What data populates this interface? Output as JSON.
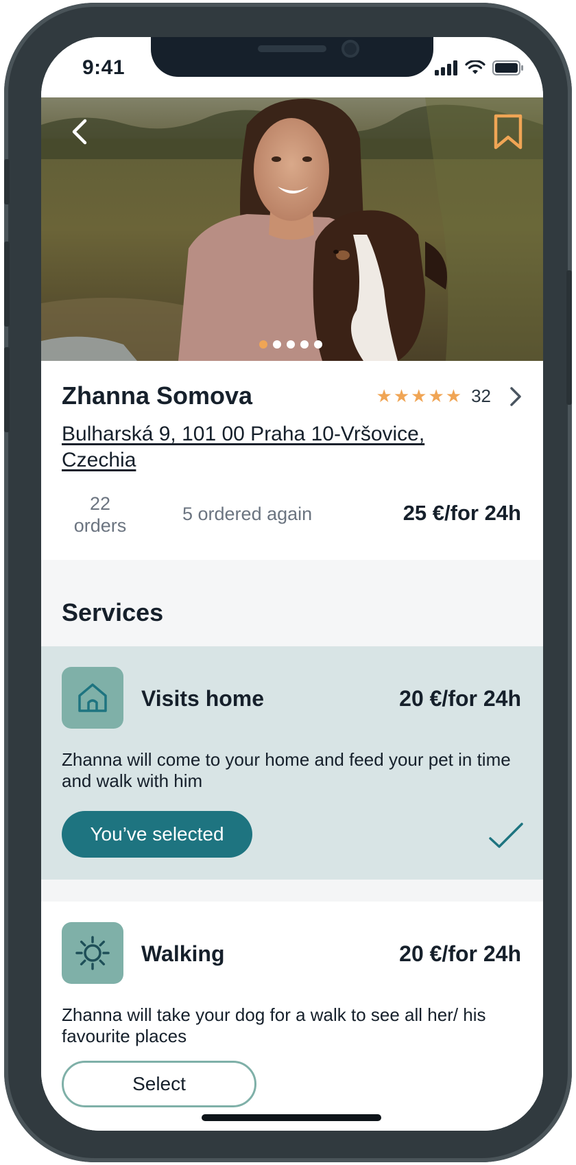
{
  "status_bar": {
    "time": "9:41"
  },
  "hero": {
    "photo_count": 5,
    "active_photo": 1,
    "icons": [
      "chevron-left-icon",
      "bookmark-icon"
    ]
  },
  "profile": {
    "name": "Zhanna Somova",
    "rating_stars": 5,
    "review_count": "32",
    "address": "Bulharská 9, 101 00 Praha 10-Vršovice, Czechia",
    "orders": "22 orders",
    "ordered_again": "5 ordered again",
    "price": "25 €/for 24h"
  },
  "services": {
    "title": "Services",
    "items": [
      {
        "name": "Visits home",
        "price": "20 €/for 24h",
        "description": "Zhanna will come to your home and feed your pet in time and walk with him",
        "button": "You’ve selected",
        "icon": "house-icon",
        "selected": true
      },
      {
        "name": "Walking",
        "price": "20 €/for 24h",
        "description": "Zhanna will take your dog for a walk to see all her/ his favourite places",
        "button": "Select",
        "icon": "sun-icon",
        "selected": false
      }
    ]
  },
  "colors": {
    "accent_orange": "#f0a555",
    "teal_dark": "#1e7480",
    "teal_light": "#7fb0a8",
    "selected_bg": "#d8e4e5",
    "text_dark": "#16202b",
    "text_muted": "#6b7480"
  }
}
